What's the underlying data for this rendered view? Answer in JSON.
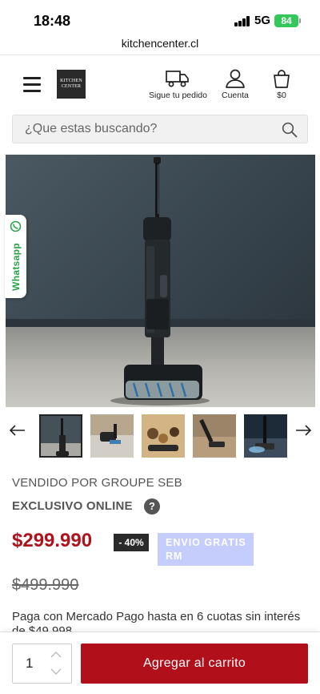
{
  "status_bar": {
    "time": "18:48",
    "network": "5G",
    "battery": "84"
  },
  "browser": {
    "url": "kitchencenter.cl"
  },
  "header": {
    "logo_text": "KITCHEN CENTER",
    "track_order_label": "Sigue tu pedido",
    "account_label": "Cuenta",
    "cart_total": "$0"
  },
  "search": {
    "placeholder": "¿Que estas buscando?"
  },
  "whatsapp": {
    "label": "Whatsapp",
    "color": "#25a244"
  },
  "product": {
    "seller": "VENDIDO POR GROUPE SEB",
    "exclusive": "EXCLUSIVO ONLINE",
    "help": "?",
    "price": "$299.990",
    "discount": "- 40%",
    "shipping_badge": "ENVIO GRATIS RM",
    "old_price": "$499.990",
    "payment_note": "Paga con Mercado Pago hasta en 6 cuotas sin interés de $49.998"
  },
  "gallery": {
    "thumbnail_count": 5,
    "selected_index": 0
  },
  "purchase": {
    "quantity": "1",
    "add_to_cart_label": "Agregar al carrito"
  },
  "colors": {
    "brand_red": "#b10f1a",
    "price_red": "#b0121b",
    "shipping_badge": "#c5cdfc"
  }
}
